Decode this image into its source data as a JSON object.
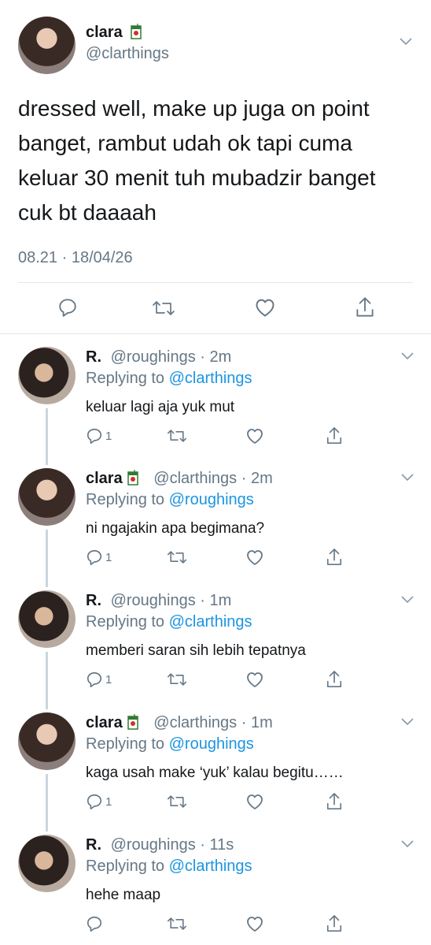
{
  "main_tweet": {
    "display_name": "clara",
    "handle": "@clarthings",
    "text": "dressed well, make up juga on point banget, rambut udah ok tapi cuma keluar 30 menit tuh mubadzir banget cuk bt daaaah",
    "timestamp": "08.21 · 18/04/26"
  },
  "replies": [
    {
      "name": "R.",
      "handle": "@roughings",
      "time": "2m",
      "replying_label": "Replying to",
      "replying_to": "@clarthings",
      "text": "keluar lagi aja yuk mut",
      "reply_count": "1"
    },
    {
      "name": "clara",
      "handle": "@clarthings",
      "time": "2m",
      "replying_label": "Replying to",
      "replying_to": "@roughings",
      "text": "ni ngajakin apa begimana?",
      "reply_count": "1"
    },
    {
      "name": "R.",
      "handle": "@roughings",
      "time": "1m",
      "replying_label": "Replying to",
      "replying_to": "@clarthings",
      "text": "memberi saran sih lebih tepatnya",
      "reply_count": "1"
    },
    {
      "name": "clara",
      "handle": "@clarthings",
      "time": "1m",
      "replying_label": "Replying to",
      "replying_to": "@roughings",
      "text": "kaga usah make ‘yuk’ kalau begitu……",
      "reply_count": "1"
    },
    {
      "name": "R.",
      "handle": "@roughings",
      "time": "11s",
      "replying_label": "Replying to",
      "replying_to": "@clarthings",
      "text": "hehe maap",
      "reply_count": ""
    }
  ],
  "sep": "·",
  "icons": [
    "reply-icon",
    "retweet-icon",
    "like-icon",
    "share-icon",
    "chevron-down-icon",
    "juice-box-icon"
  ],
  "colors": {
    "text": "#14171a",
    "secondary": "#657786",
    "link": "#1b95e0",
    "divider": "#e1e8ed",
    "thread_line": "#ccd6dd"
  }
}
